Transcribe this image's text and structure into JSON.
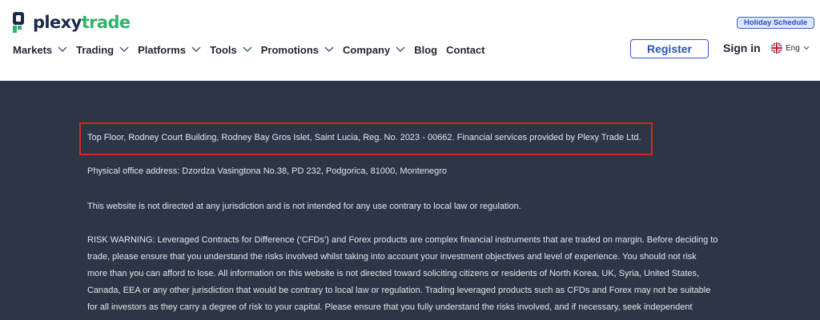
{
  "brand": {
    "name_part1": "plexy",
    "name_part2": "trade"
  },
  "header": {
    "holiday_label": "Holiday Schedule",
    "register_label": "Register",
    "signin_label": "Sign in",
    "lang_label": "Eng"
  },
  "nav": {
    "items": [
      {
        "label": "Markets",
        "dropdown": true
      },
      {
        "label": "Trading",
        "dropdown": true
      },
      {
        "label": "Platforms",
        "dropdown": true
      },
      {
        "label": "Tools",
        "dropdown": true
      },
      {
        "label": "Promotions",
        "dropdown": true
      },
      {
        "label": "Company",
        "dropdown": true
      },
      {
        "label": "Blog",
        "dropdown": false
      },
      {
        "label": "Contact",
        "dropdown": false
      }
    ]
  },
  "footer": {
    "registration": "Top Floor, Rodney Court Building, Rodney Bay Gros Islet, Saint Lucia, Reg. No. 2023 - 00662. Financial services provided by Plexy Trade Ltd.",
    "office_address": "Physical office address: Dzordza Vasingtona No.38, PD 232, Podgorica, 81000, Montenegro",
    "jurisdiction": "This website is not directed at any jurisdiction and is not intended for any use contrary to local law or regulation.",
    "risk_lines": [
      "RISK WARNING: Leveraged Contracts for Difference (‘CFDs’) and Forex products are complex financial instruments that are traded on margin. Before deciding to",
      "trade, please ensure that you understand the risks involved whilst taking into account your investment objectives and level of experience. You should not risk",
      "more than you can afford to lose. All information on this website is not directed toward soliciting citizens or residents of North Korea, UK, Syria, United States,",
      "Canada, EEA or any other jurisdiction that would be contrary to local law or regulation. Trading leveraged products such as CFDs and Forex may not be suitable",
      "for all investors as they carry a degree of risk to your capital. Please ensure that you fully understand the risks involved, and if necessary, seek independent"
    ]
  },
  "colors": {
    "brand_green": "#2fb36a",
    "brand_navy": "#1b2a4a",
    "footer_bg": "#2c3646",
    "accent_blue": "#2f5bd0",
    "highlight_red": "#d9261c"
  }
}
